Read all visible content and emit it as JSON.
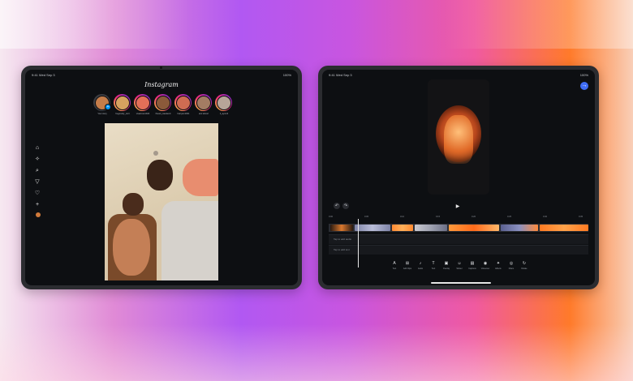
{
  "left_ipad": {
    "status": {
      "time": "9:41",
      "date": "Wed Sep 3",
      "battery": "100%"
    },
    "logo_text": "Instagram",
    "stories": [
      {
        "name": "Your story",
        "color": "#c57d4a",
        "seen": true
      },
      {
        "name": "hugoosky_cwrt",
        "color": "#d7a35f",
        "seen": false
      },
      {
        "name": "vivacious1024",
        "color": "#e36f58",
        "seen": false
      },
      {
        "name": "finestt_weekend",
        "color": "#8b5a3a",
        "seen": false
      },
      {
        "name": "hari.jam1001",
        "color": "#cf6c52",
        "seen": false
      },
      {
        "name": "amr.almori",
        "color": "#a37c63",
        "seen": false
      },
      {
        "name": "it_ayomil",
        "color": "#b7a598",
        "seen": false
      }
    ],
    "sidebar": [
      {
        "name": "home-icon",
        "glyph": "⌂"
      },
      {
        "name": "reels-icon",
        "glyph": "✧"
      },
      {
        "name": "search-icon",
        "glyph": "⌕"
      },
      {
        "name": "send-icon",
        "glyph": "▽"
      },
      {
        "name": "heart-icon",
        "glyph": "♡"
      },
      {
        "name": "create-icon",
        "glyph": "+"
      }
    ]
  },
  "right_ipad": {
    "status": {
      "time": "9:41",
      "date": "Wed Sep 3",
      "battery": "100%"
    },
    "export_glyph": "→",
    "undo_glyph": "↶",
    "redo_glyph": "↷",
    "play_glyph": "▶",
    "ruler_ticks": [
      "0:00",
      "0:05",
      "0:10",
      "0:15",
      "0:20",
      "0:25",
      "0:30",
      "0:35"
    ],
    "tracks": [
      {
        "label": "Tap to add audio"
      },
      {
        "label": "Tap to add text"
      }
    ],
    "tools": [
      {
        "label": "Text",
        "glyph": "A",
        "name": "text-tool-icon"
      },
      {
        "label": "Add Clips",
        "glyph": "⊞",
        "name": "add-clips-icon"
      },
      {
        "label": "Audio",
        "glyph": "♪",
        "name": "audio-icon"
      },
      {
        "label": "Text",
        "glyph": "T",
        "name": "text-icon"
      },
      {
        "label": "Overlay",
        "glyph": "▣",
        "name": "overlay-icon"
      },
      {
        "label": "Sticker",
        "glyph": "☺",
        "name": "sticker-icon"
      },
      {
        "label": "Captions",
        "glyph": "▤",
        "name": "captions-icon"
      },
      {
        "label": "Voiceover",
        "glyph": "◉",
        "name": "voiceover-icon"
      },
      {
        "label": "Effects",
        "glyph": "✦",
        "name": "effects-icon"
      },
      {
        "label": "Filters",
        "glyph": "◎",
        "name": "filters-icon"
      },
      {
        "label": "Rotate",
        "glyph": "↻",
        "name": "rotate-icon"
      }
    ]
  }
}
